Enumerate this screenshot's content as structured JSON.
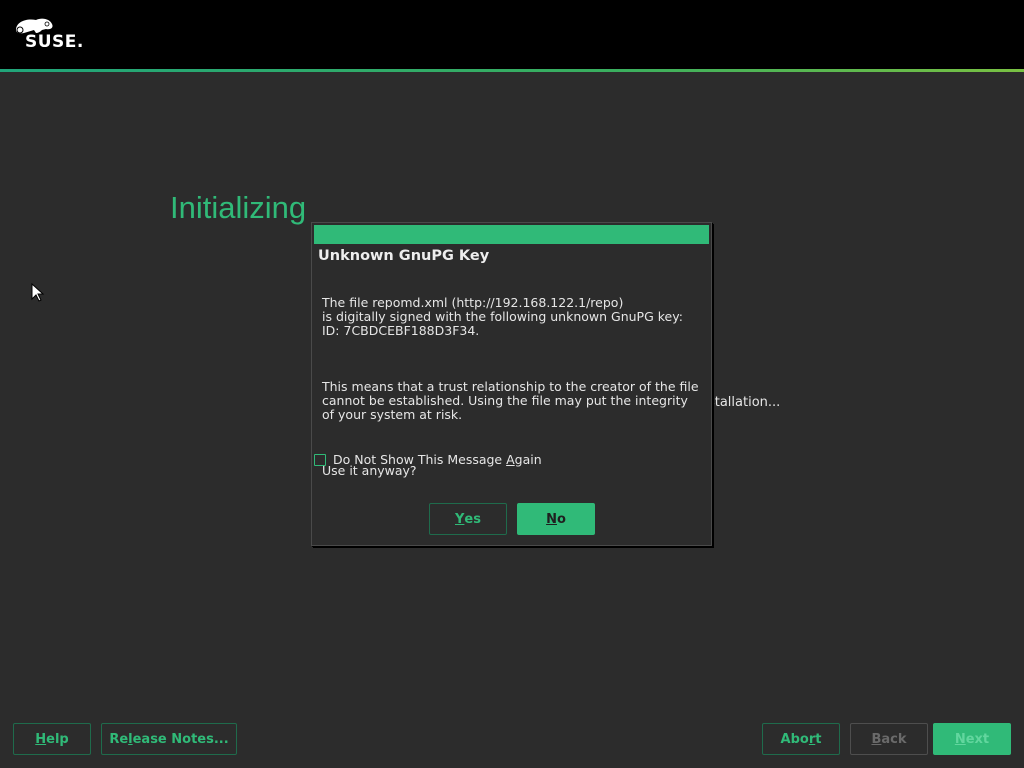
{
  "header": {
    "logo_text": "SUSE.",
    "accent_gradient": [
      "#21a57a",
      "#7ac143"
    ]
  },
  "page": {
    "title": "Initializing",
    "background_status": "Initializing the installation..."
  },
  "dialog": {
    "title": "Unknown GnuPG Key",
    "body_paragraphs": [
      "The file repomd.xml (http://192.168.122.1/repo)\nis digitally signed with the following unknown GnuPG key:\nID: 7CBDCEBF188D3F34.",
      "This means that a trust relationship to the creator of the file\ncannot be established. Using the file may put the integrity\nof your system at risk.",
      "Use it anyway?"
    ],
    "checkbox": {
      "label_before": "Do Not Show This Message ",
      "label_mnemonic": "A",
      "label_after": "gain",
      "checked": false
    },
    "buttons": {
      "yes": {
        "mnemonic": "Y",
        "rest": "es"
      },
      "no": {
        "mnemonic": "N",
        "rest": "o"
      }
    }
  },
  "footer": {
    "help": {
      "mnemonic": "H",
      "rest": "elp"
    },
    "release_notes": {
      "before": "Re",
      "mnemonic": "l",
      "rest": "ease Notes..."
    },
    "abort": {
      "before": "Abo",
      "mnemonic": "r",
      "rest": "t"
    },
    "back": {
      "mnemonic": "B",
      "rest": "ack",
      "enabled": false
    },
    "next": {
      "mnemonic": "N",
      "rest": "ext",
      "enabled": false
    }
  },
  "colors": {
    "accent": "#30ba78",
    "background": "#2c2c2c",
    "header": "#000000"
  }
}
